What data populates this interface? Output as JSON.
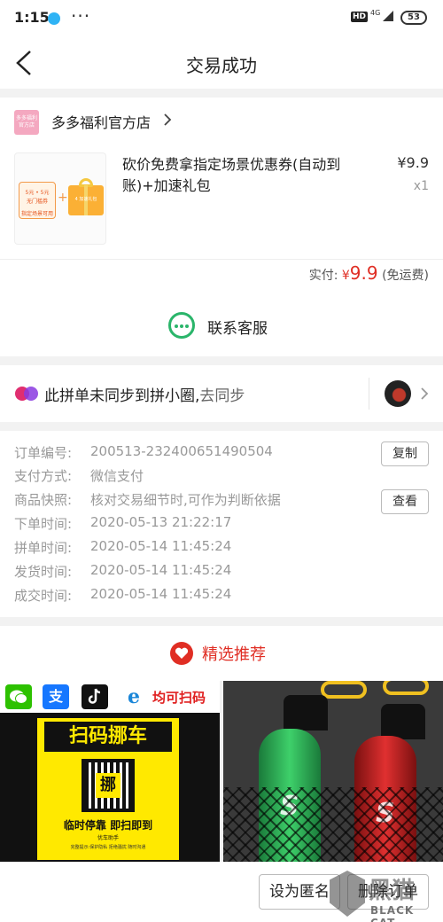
{
  "status": {
    "time": "1:15",
    "more": "···",
    "hd": "HD",
    "net": "4G",
    "battery": "53"
  },
  "nav": {
    "title": "交易成功"
  },
  "shop": {
    "logo_text": "多多福利官方店",
    "name": "多多福利官方店",
    "product_title": "砍价免费拿指定场景优惠券(自动到账)+加速礼包",
    "ticket_line1": "5元 • 5元",
    "ticket_line2": "无门槛券",
    "ticket_line3": "指定场景可用",
    "gift_label": "4 加速礼包",
    "price": "¥9.9",
    "qty": "x1",
    "paid_label": "实付:",
    "paid_symbol": "¥",
    "paid_amount": "9.9",
    "paid_note": "(免运费)"
  },
  "service": {
    "label": "联系客服"
  },
  "sync": {
    "text": "此拼单未同步到拼小圈,",
    "link": "去同步"
  },
  "order": {
    "rows": [
      {
        "label": "订单编号:",
        "value": "200513-232400651490504"
      },
      {
        "label": "支付方式:",
        "value": "微信支付"
      },
      {
        "label": "商品快照:",
        "value": "核对交易细节时,可作为判断依据"
      },
      {
        "label": "下单时间:",
        "value": "2020-05-13 21:22:17"
      },
      {
        "label": "拼单时间:",
        "value": "2020-05-14 11:45:24"
      },
      {
        "label": "发货时间:",
        "value": "2020-05-14 11:45:24"
      },
      {
        "label": "成交时间:",
        "value": "2020-05-14 11:45:24"
      }
    ],
    "copy_button": "复制",
    "view_button": "查看"
  },
  "recommend": {
    "label": "精选推荐"
  },
  "products": {
    "p1": {
      "icon_alipay": "支",
      "scan_text": "均可扫码",
      "headline": "扫码挪车",
      "qr_char": "挪",
      "sub": "临时停靠  即扫即到",
      "sub2": "优车助手",
      "sub3": "完整提示:保护隐私 拒绝骚扰 随时沟通"
    },
    "p2": {
      "bottle_text": "S"
    }
  },
  "bottom": {
    "anon_button": "设为匿名",
    "delete_button": "删除订单"
  },
  "watermark": {
    "logo": "黑猫",
    "text": "BLACK CAT"
  }
}
